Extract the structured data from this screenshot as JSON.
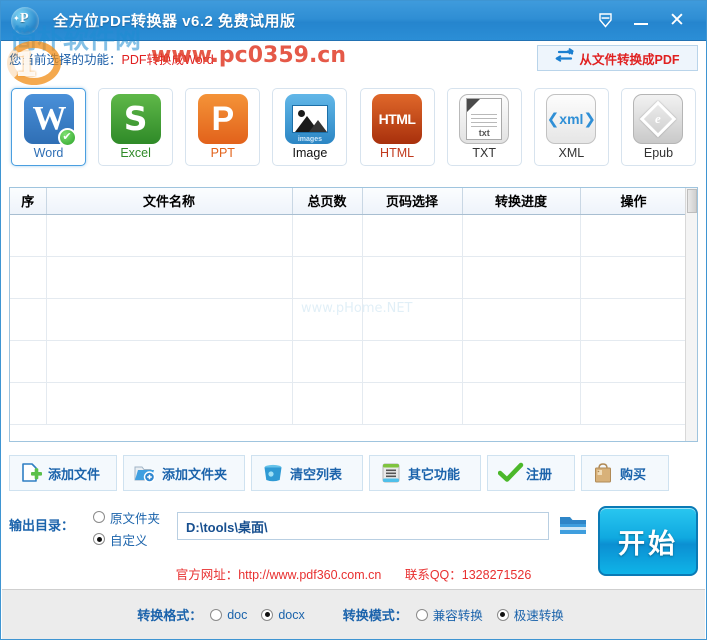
{
  "window": {
    "title": "全方位PDF转换器 v6.2 免费试用版",
    "logo_letter": "P",
    "controls": {
      "tray_icon": "tray-down-icon",
      "minimize_icon": "minimize-icon",
      "close_icon": "close-icon"
    }
  },
  "funcline": {
    "label": "您当前选择的功能：",
    "value": "PDF转换成Word",
    "to_pdf_button": "从文件转换成PDF",
    "to_pdf_icon": "swap-arrows-icon"
  },
  "formats": [
    {
      "label": "Word",
      "glyph": "W",
      "icon": "word-icon",
      "selected": true
    },
    {
      "label": "Excel",
      "glyph": "S",
      "icon": "excel-icon",
      "selected": false
    },
    {
      "label": "PPT",
      "glyph": "P",
      "icon": "ppt-icon",
      "selected": false
    },
    {
      "label": "Image",
      "glyph": "images",
      "icon": "image-icon",
      "selected": false
    },
    {
      "label": "HTML",
      "glyph": "HTML",
      "icon": "html-icon",
      "selected": false
    },
    {
      "label": "TXT",
      "glyph": "txt",
      "icon": "txt-icon",
      "selected": false
    },
    {
      "label": "XML",
      "glyph": "xml",
      "icon": "xml-icon",
      "selected": false
    },
    {
      "label": "Epub",
      "glyph": "e",
      "icon": "epub-icon",
      "selected": false
    }
  ],
  "table": {
    "columns": [
      "序",
      "文件名称",
      "总页数",
      "页码选择",
      "转换进度",
      "操作"
    ],
    "rows": [],
    "empty_row_count": 5,
    "scrollbar": "vertical-scrollbar"
  },
  "actions": [
    {
      "label": "添加文件",
      "icon": "add-file-icon"
    },
    {
      "label": "添加文件夹",
      "icon": "add-folder-icon"
    },
    {
      "label": "清空列表",
      "icon": "trash-icon"
    },
    {
      "label": "其它功能",
      "icon": "other-functions-icon"
    },
    {
      "label": "注册",
      "icon": "check-icon"
    },
    {
      "label": "购买",
      "icon": "shopping-bag-icon"
    }
  ],
  "output": {
    "label": "输出目录：",
    "options": [
      {
        "label": "原文件夹",
        "selected": false
      },
      {
        "label": "自定义",
        "selected": true
      }
    ],
    "path_value": "D:\\tools\\桌面\\",
    "path_placeholder": "D:\\tools\\桌面\\",
    "browse_icon": "folder-icon",
    "start_button": "开始"
  },
  "contact": {
    "website": "官方网址：http://www.pdf360.com.cn",
    "qq": "联系QQ：1328271526"
  },
  "bottom": {
    "format_label": "转换格式：",
    "format_options": [
      {
        "label": "doc",
        "selected": false
      },
      {
        "label": "docx",
        "selected": true
      }
    ],
    "mode_label": "转换模式：",
    "mode_options": [
      {
        "label": "兼容转换",
        "selected": false
      },
      {
        "label": "极速转换",
        "selected": true
      }
    ]
  },
  "watermarks": {
    "line1": "简朴软件网",
    "line2": "www.pc0359.cn",
    "line3": "www.pHome.NET",
    "digit": "1"
  },
  "colors": {
    "titlebar": "#2f8ed4",
    "accent_blue": "#1b63ab",
    "red": "#e02020",
    "start_button": "#10a9e0",
    "bottom_bar": "#ececec"
  }
}
